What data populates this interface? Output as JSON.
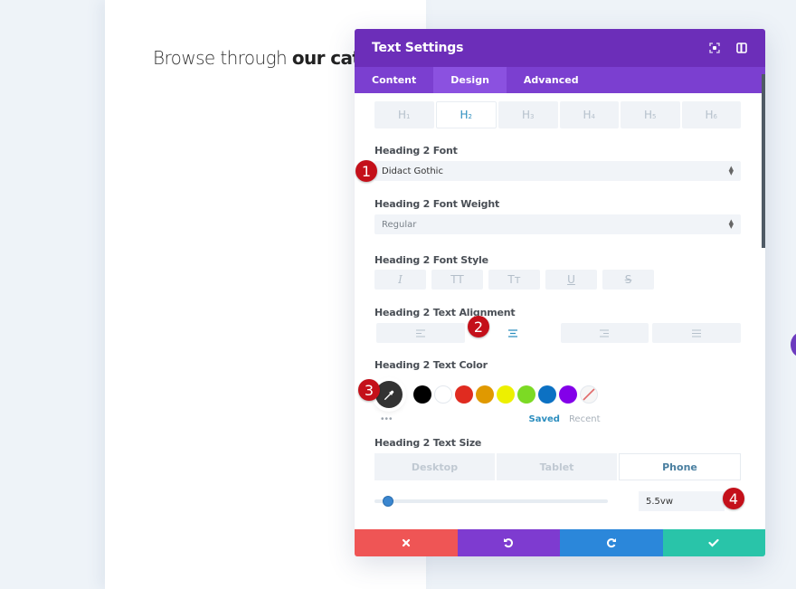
{
  "page": {
    "heading_light": "Browse through ",
    "heading_bold": "our catalog"
  },
  "modal": {
    "title": "Text Settings",
    "header_icons": [
      "fullscreen-icon",
      "sidebar-toggle-icon"
    ],
    "tabs": [
      {
        "label": "Content",
        "active": false
      },
      {
        "label": "Design",
        "active": true
      },
      {
        "label": "Advanced",
        "active": false
      }
    ],
    "heading_tabs": [
      {
        "letter": "H",
        "level": "1",
        "active": false
      },
      {
        "letter": "H",
        "level": "2",
        "active": true
      },
      {
        "letter": "H",
        "level": "3",
        "active": false
      },
      {
        "letter": "H",
        "level": "4",
        "active": false
      },
      {
        "letter": "H",
        "level": "5",
        "active": false
      },
      {
        "letter": "H",
        "level": "6",
        "active": false
      }
    ],
    "font": {
      "label": "Heading 2 Font",
      "value": "Didact Gothic"
    },
    "weight": {
      "label": "Heading 2 Font Weight",
      "value": "Regular"
    },
    "style": {
      "label": "Heading 2 Font Style",
      "buttons": [
        {
          "name": "italic",
          "glyph": "I"
        },
        {
          "name": "uppercase",
          "glyph": "TT"
        },
        {
          "name": "capitalize",
          "glyph": "Tт"
        },
        {
          "name": "underline",
          "glyph": "U"
        },
        {
          "name": "strikethrough",
          "glyph": "S"
        }
      ]
    },
    "alignment": {
      "label": "Heading 2 Text Alignment",
      "options": [
        "left",
        "center",
        "right",
        "justify"
      ],
      "selected": "center"
    },
    "color": {
      "label": "Heading 2 Text Color",
      "swatches": [
        "#000000",
        "#ffffff",
        "#e02b20",
        "#e09900",
        "#edf000",
        "#7cda24",
        "#0c71c3",
        "#8300e9",
        "none"
      ],
      "more_label": "•••",
      "saved_label": "Saved",
      "recent_label": "Recent"
    },
    "size": {
      "label": "Heading 2 Text Size",
      "devices": [
        {
          "label": "Desktop",
          "active": false
        },
        {
          "label": "Tablet",
          "active": false
        },
        {
          "label": "Phone",
          "active": true
        }
      ],
      "value": "5.5vw",
      "slider_fraction": 0.06
    },
    "footer": [
      {
        "name": "cancel",
        "color": "#ef5555"
      },
      {
        "name": "undo",
        "color": "#7e3bd0"
      },
      {
        "name": "redo",
        "color": "#2b87da"
      },
      {
        "name": "save",
        "color": "#29c4a9"
      }
    ]
  },
  "badges": [
    "1",
    "2",
    "3",
    "4"
  ],
  "colors": {
    "header": "#6c2eb9",
    "tabs_bg": "#7b3fd0",
    "active_tab": "#8b51e0",
    "accent_blue": "#2c8ebf",
    "badge_red": "#c4101a"
  }
}
